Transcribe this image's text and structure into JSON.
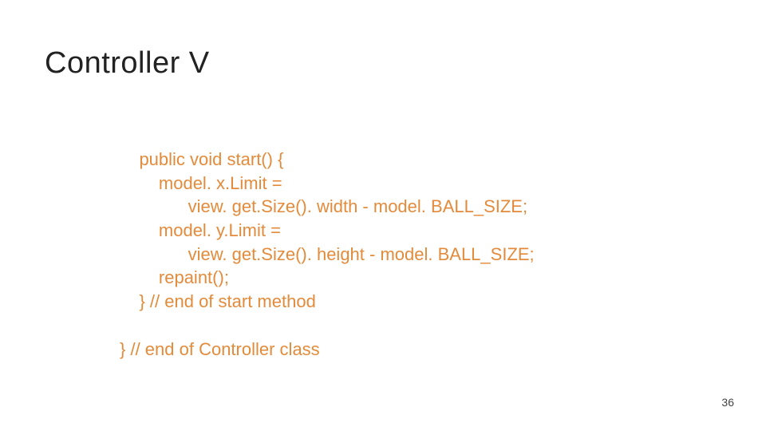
{
  "slide": {
    "title": "Controller V",
    "code": {
      "l1": "    public void start() {",
      "l2": "        model. x.Limit =",
      "l3": "              view. get.Size(). width - model. BALL_SIZE;",
      "l4": "        model. y.Limit =",
      "l5": "              view. get.Size(). height - model. BALL_SIZE;",
      "l6": "        repaint();",
      "l7": "    } // end of start method",
      "l8": "",
      "l9": "} // end of Controller class"
    },
    "page_number": "36"
  }
}
